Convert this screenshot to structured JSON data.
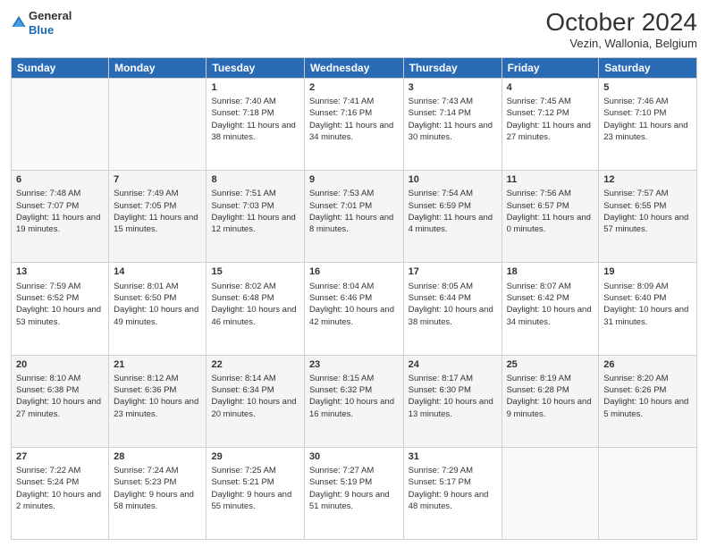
{
  "header": {
    "logo_line1": "General",
    "logo_line2": "Blue",
    "title": "October 2024",
    "subtitle": "Vezin, Wallonia, Belgium"
  },
  "weekdays": [
    "Sunday",
    "Monday",
    "Tuesday",
    "Wednesday",
    "Thursday",
    "Friday",
    "Saturday"
  ],
  "weeks": [
    [
      {
        "day": "",
        "sunrise": "",
        "sunset": "",
        "daylight": ""
      },
      {
        "day": "",
        "sunrise": "",
        "sunset": "",
        "daylight": ""
      },
      {
        "day": "1",
        "sunrise": "Sunrise: 7:40 AM",
        "sunset": "Sunset: 7:18 PM",
        "daylight": "Daylight: 11 hours and 38 minutes."
      },
      {
        "day": "2",
        "sunrise": "Sunrise: 7:41 AM",
        "sunset": "Sunset: 7:16 PM",
        "daylight": "Daylight: 11 hours and 34 minutes."
      },
      {
        "day": "3",
        "sunrise": "Sunrise: 7:43 AM",
        "sunset": "Sunset: 7:14 PM",
        "daylight": "Daylight: 11 hours and 30 minutes."
      },
      {
        "day": "4",
        "sunrise": "Sunrise: 7:45 AM",
        "sunset": "Sunset: 7:12 PM",
        "daylight": "Daylight: 11 hours and 27 minutes."
      },
      {
        "day": "5",
        "sunrise": "Sunrise: 7:46 AM",
        "sunset": "Sunset: 7:10 PM",
        "daylight": "Daylight: 11 hours and 23 minutes."
      }
    ],
    [
      {
        "day": "6",
        "sunrise": "Sunrise: 7:48 AM",
        "sunset": "Sunset: 7:07 PM",
        "daylight": "Daylight: 11 hours and 19 minutes."
      },
      {
        "day": "7",
        "sunrise": "Sunrise: 7:49 AM",
        "sunset": "Sunset: 7:05 PM",
        "daylight": "Daylight: 11 hours and 15 minutes."
      },
      {
        "day": "8",
        "sunrise": "Sunrise: 7:51 AM",
        "sunset": "Sunset: 7:03 PM",
        "daylight": "Daylight: 11 hours and 12 minutes."
      },
      {
        "day": "9",
        "sunrise": "Sunrise: 7:53 AM",
        "sunset": "Sunset: 7:01 PM",
        "daylight": "Daylight: 11 hours and 8 minutes."
      },
      {
        "day": "10",
        "sunrise": "Sunrise: 7:54 AM",
        "sunset": "Sunset: 6:59 PM",
        "daylight": "Daylight: 11 hours and 4 minutes."
      },
      {
        "day": "11",
        "sunrise": "Sunrise: 7:56 AM",
        "sunset": "Sunset: 6:57 PM",
        "daylight": "Daylight: 11 hours and 0 minutes."
      },
      {
        "day": "12",
        "sunrise": "Sunrise: 7:57 AM",
        "sunset": "Sunset: 6:55 PM",
        "daylight": "Daylight: 10 hours and 57 minutes."
      }
    ],
    [
      {
        "day": "13",
        "sunrise": "Sunrise: 7:59 AM",
        "sunset": "Sunset: 6:52 PM",
        "daylight": "Daylight: 10 hours and 53 minutes."
      },
      {
        "day": "14",
        "sunrise": "Sunrise: 8:01 AM",
        "sunset": "Sunset: 6:50 PM",
        "daylight": "Daylight: 10 hours and 49 minutes."
      },
      {
        "day": "15",
        "sunrise": "Sunrise: 8:02 AM",
        "sunset": "Sunset: 6:48 PM",
        "daylight": "Daylight: 10 hours and 46 minutes."
      },
      {
        "day": "16",
        "sunrise": "Sunrise: 8:04 AM",
        "sunset": "Sunset: 6:46 PM",
        "daylight": "Daylight: 10 hours and 42 minutes."
      },
      {
        "day": "17",
        "sunrise": "Sunrise: 8:05 AM",
        "sunset": "Sunset: 6:44 PM",
        "daylight": "Daylight: 10 hours and 38 minutes."
      },
      {
        "day": "18",
        "sunrise": "Sunrise: 8:07 AM",
        "sunset": "Sunset: 6:42 PM",
        "daylight": "Daylight: 10 hours and 34 minutes."
      },
      {
        "day": "19",
        "sunrise": "Sunrise: 8:09 AM",
        "sunset": "Sunset: 6:40 PM",
        "daylight": "Daylight: 10 hours and 31 minutes."
      }
    ],
    [
      {
        "day": "20",
        "sunrise": "Sunrise: 8:10 AM",
        "sunset": "Sunset: 6:38 PM",
        "daylight": "Daylight: 10 hours and 27 minutes."
      },
      {
        "day": "21",
        "sunrise": "Sunrise: 8:12 AM",
        "sunset": "Sunset: 6:36 PM",
        "daylight": "Daylight: 10 hours and 23 minutes."
      },
      {
        "day": "22",
        "sunrise": "Sunrise: 8:14 AM",
        "sunset": "Sunset: 6:34 PM",
        "daylight": "Daylight: 10 hours and 20 minutes."
      },
      {
        "day": "23",
        "sunrise": "Sunrise: 8:15 AM",
        "sunset": "Sunset: 6:32 PM",
        "daylight": "Daylight: 10 hours and 16 minutes."
      },
      {
        "day": "24",
        "sunrise": "Sunrise: 8:17 AM",
        "sunset": "Sunset: 6:30 PM",
        "daylight": "Daylight: 10 hours and 13 minutes."
      },
      {
        "day": "25",
        "sunrise": "Sunrise: 8:19 AM",
        "sunset": "Sunset: 6:28 PM",
        "daylight": "Daylight: 10 hours and 9 minutes."
      },
      {
        "day": "26",
        "sunrise": "Sunrise: 8:20 AM",
        "sunset": "Sunset: 6:26 PM",
        "daylight": "Daylight: 10 hours and 5 minutes."
      }
    ],
    [
      {
        "day": "27",
        "sunrise": "Sunrise: 7:22 AM",
        "sunset": "Sunset: 5:24 PM",
        "daylight": "Daylight: 10 hours and 2 minutes."
      },
      {
        "day": "28",
        "sunrise": "Sunrise: 7:24 AM",
        "sunset": "Sunset: 5:23 PM",
        "daylight": "Daylight: 9 hours and 58 minutes."
      },
      {
        "day": "29",
        "sunrise": "Sunrise: 7:25 AM",
        "sunset": "Sunset: 5:21 PM",
        "daylight": "Daylight: 9 hours and 55 minutes."
      },
      {
        "day": "30",
        "sunrise": "Sunrise: 7:27 AM",
        "sunset": "Sunset: 5:19 PM",
        "daylight": "Daylight: 9 hours and 51 minutes."
      },
      {
        "day": "31",
        "sunrise": "Sunrise: 7:29 AM",
        "sunset": "Sunset: 5:17 PM",
        "daylight": "Daylight: 9 hours and 48 minutes."
      },
      {
        "day": "",
        "sunrise": "",
        "sunset": "",
        "daylight": ""
      },
      {
        "day": "",
        "sunrise": "",
        "sunset": "",
        "daylight": ""
      }
    ]
  ]
}
